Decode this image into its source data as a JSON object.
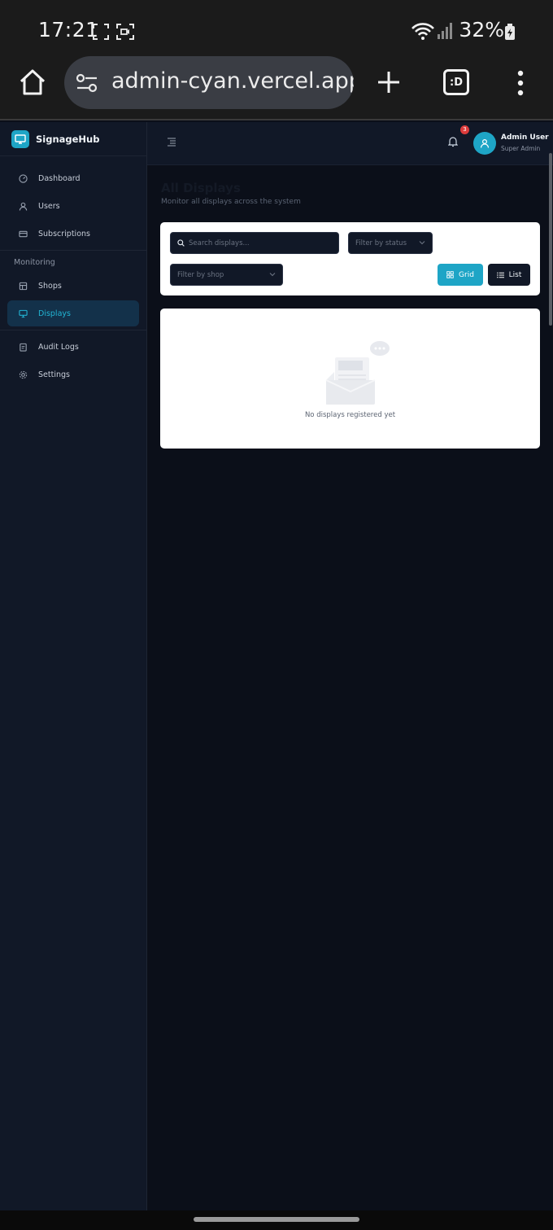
{
  "status_bar": {
    "time": "17:21",
    "battery": "32%"
  },
  "browser": {
    "url": "admin-cyan.vercel.app",
    "tab_button": ":D"
  },
  "sidebar": {
    "brand": "SignageHub",
    "items": [
      {
        "label": "Dashboard",
        "icon": "gauge-icon"
      },
      {
        "label": "Users",
        "icon": "user-icon"
      },
      {
        "label": "Subscriptions",
        "icon": "card-icon"
      }
    ],
    "section_label": "Monitoring",
    "monitoring_items": [
      {
        "label": "Shops",
        "icon": "store-icon"
      },
      {
        "label": "Displays",
        "icon": "monitor-icon",
        "active": true
      }
    ],
    "bottom_items": [
      {
        "label": "Audit Logs",
        "icon": "clipboard-icon"
      },
      {
        "label": "Settings",
        "icon": "gear-icon"
      }
    ]
  },
  "topbar": {
    "notification_count": "3",
    "user_name": "Admin User",
    "user_role": "Super Admin"
  },
  "page": {
    "title": "All Displays",
    "subtitle": "Monitor all displays across the system"
  },
  "filters": {
    "search_placeholder": "Search displays...",
    "status_placeholder": "Filter by status",
    "shop_placeholder": "Filter by shop",
    "grid_label": "Grid",
    "list_label": "List"
  },
  "empty_state": {
    "message": "No displays registered yet"
  },
  "colors": {
    "accent": "#1ea5c6",
    "sidebar_bg": "#111827",
    "main_bg": "#0b0f19",
    "badge": "#dc3b3b"
  }
}
